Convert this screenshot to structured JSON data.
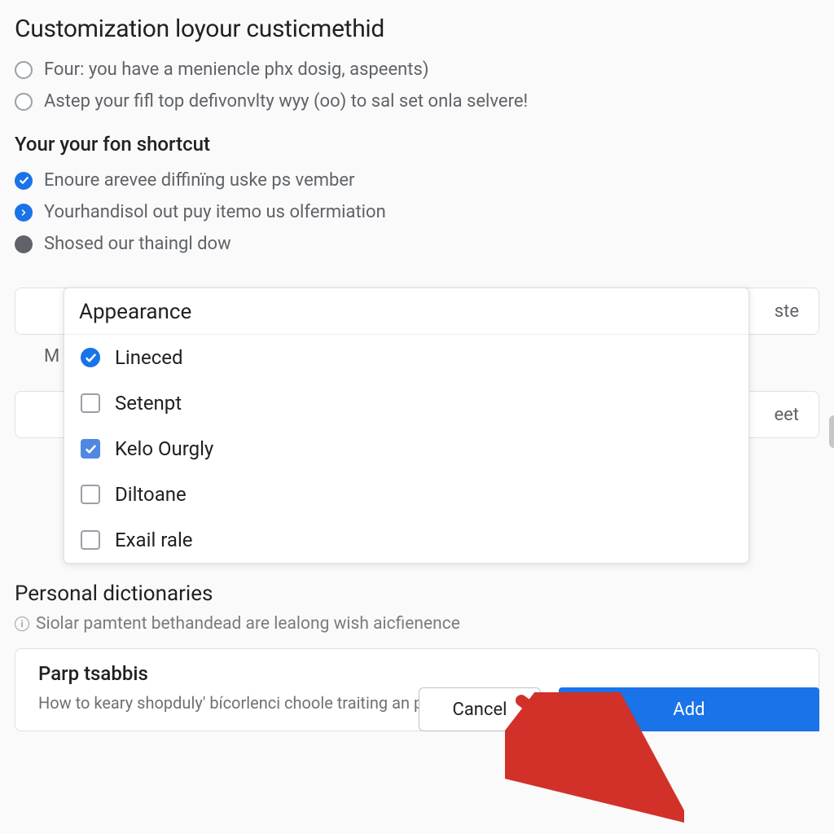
{
  "section1": {
    "title": "Customization loyour custicmethid",
    "radios": [
      {
        "label": "Four: you have a meniencle phx dosig, aspeents)"
      },
      {
        "label": "Astep your fifl top defivonvlty wyy (oo) to sal set onla selvere!"
      }
    ]
  },
  "section2": {
    "title": "Your your fon shortcut",
    "items": [
      {
        "icon": "check",
        "label": "Enoure arevee diffinïng uske ps vember"
      },
      {
        "icon": "arrow",
        "label": "Yourhandisol out puy itemo us olfermiation"
      },
      {
        "icon": "dot",
        "label": "Shosed our thaingl dow"
      }
    ]
  },
  "behind_field_right_text": "ste",
  "label_m": "M",
  "behind_field2_right_text": "eet",
  "dropdown": {
    "header": "Appearance",
    "options": [
      {
        "label": "Lineced",
        "checked": true,
        "shape": "round"
      },
      {
        "label": "Setenpt",
        "checked": false,
        "shape": "square"
      },
      {
        "label": "Kelo Ourgly",
        "checked": true,
        "shape": "square-soft"
      },
      {
        "label": "Diltoane",
        "checked": false,
        "shape": "square"
      },
      {
        "label": "Exail rale",
        "checked": false,
        "shape": "square"
      }
    ]
  },
  "personal": {
    "title": "Personal dictionaries",
    "subtitle": "Siolar pamtent bethandead are lealong wish aicfienence"
  },
  "card": {
    "title": "Parp tsabbis",
    "body": "How to keary shopduly' bícorlenci choole traiting an planp teыry ineaml."
  },
  "buttons": {
    "cancel": "Cancel",
    "add": "Add"
  },
  "colors": {
    "accent": "#1a73e8",
    "arrow": "#d13128"
  }
}
